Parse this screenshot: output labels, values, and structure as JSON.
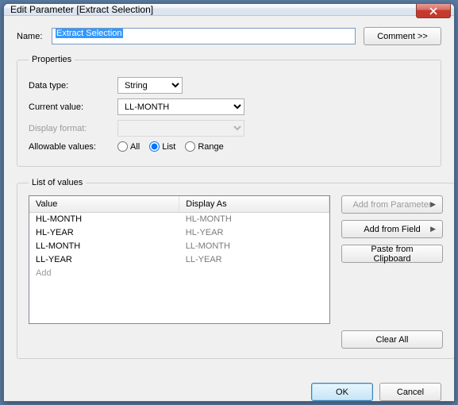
{
  "title": "Edit Parameter [Extract Selection]",
  "name_label": "Name:",
  "name_value": "Extract Selection",
  "comment_label": "Comment >>",
  "properties": {
    "legend": "Properties",
    "data_type_label": "Data type:",
    "data_type_value": "String",
    "current_value_label": "Current value:",
    "current_value_value": "LL-MONTH",
    "display_format_label": "Display format:",
    "display_format_value": "",
    "allowable_label": "Allowable values:",
    "radio_all": "All",
    "radio_list": "List",
    "radio_range": "Range"
  },
  "list": {
    "legend": "List of values",
    "col_value": "Value",
    "col_display": "Display As",
    "rows": [
      {
        "value": "HL-MONTH",
        "display": "HL-MONTH"
      },
      {
        "value": "HL-YEAR",
        "display": "HL-YEAR"
      },
      {
        "value": "LL-MONTH",
        "display": "LL-MONTH"
      },
      {
        "value": "LL-YEAR",
        "display": "LL-YEAR"
      }
    ],
    "add_row": "Add",
    "btn_add_param": "Add from Parameter",
    "btn_add_field": "Add from Field",
    "btn_paste": "Paste from Clipboard",
    "btn_clear": "Clear All"
  },
  "footer": {
    "ok": "OK",
    "cancel": "Cancel"
  }
}
